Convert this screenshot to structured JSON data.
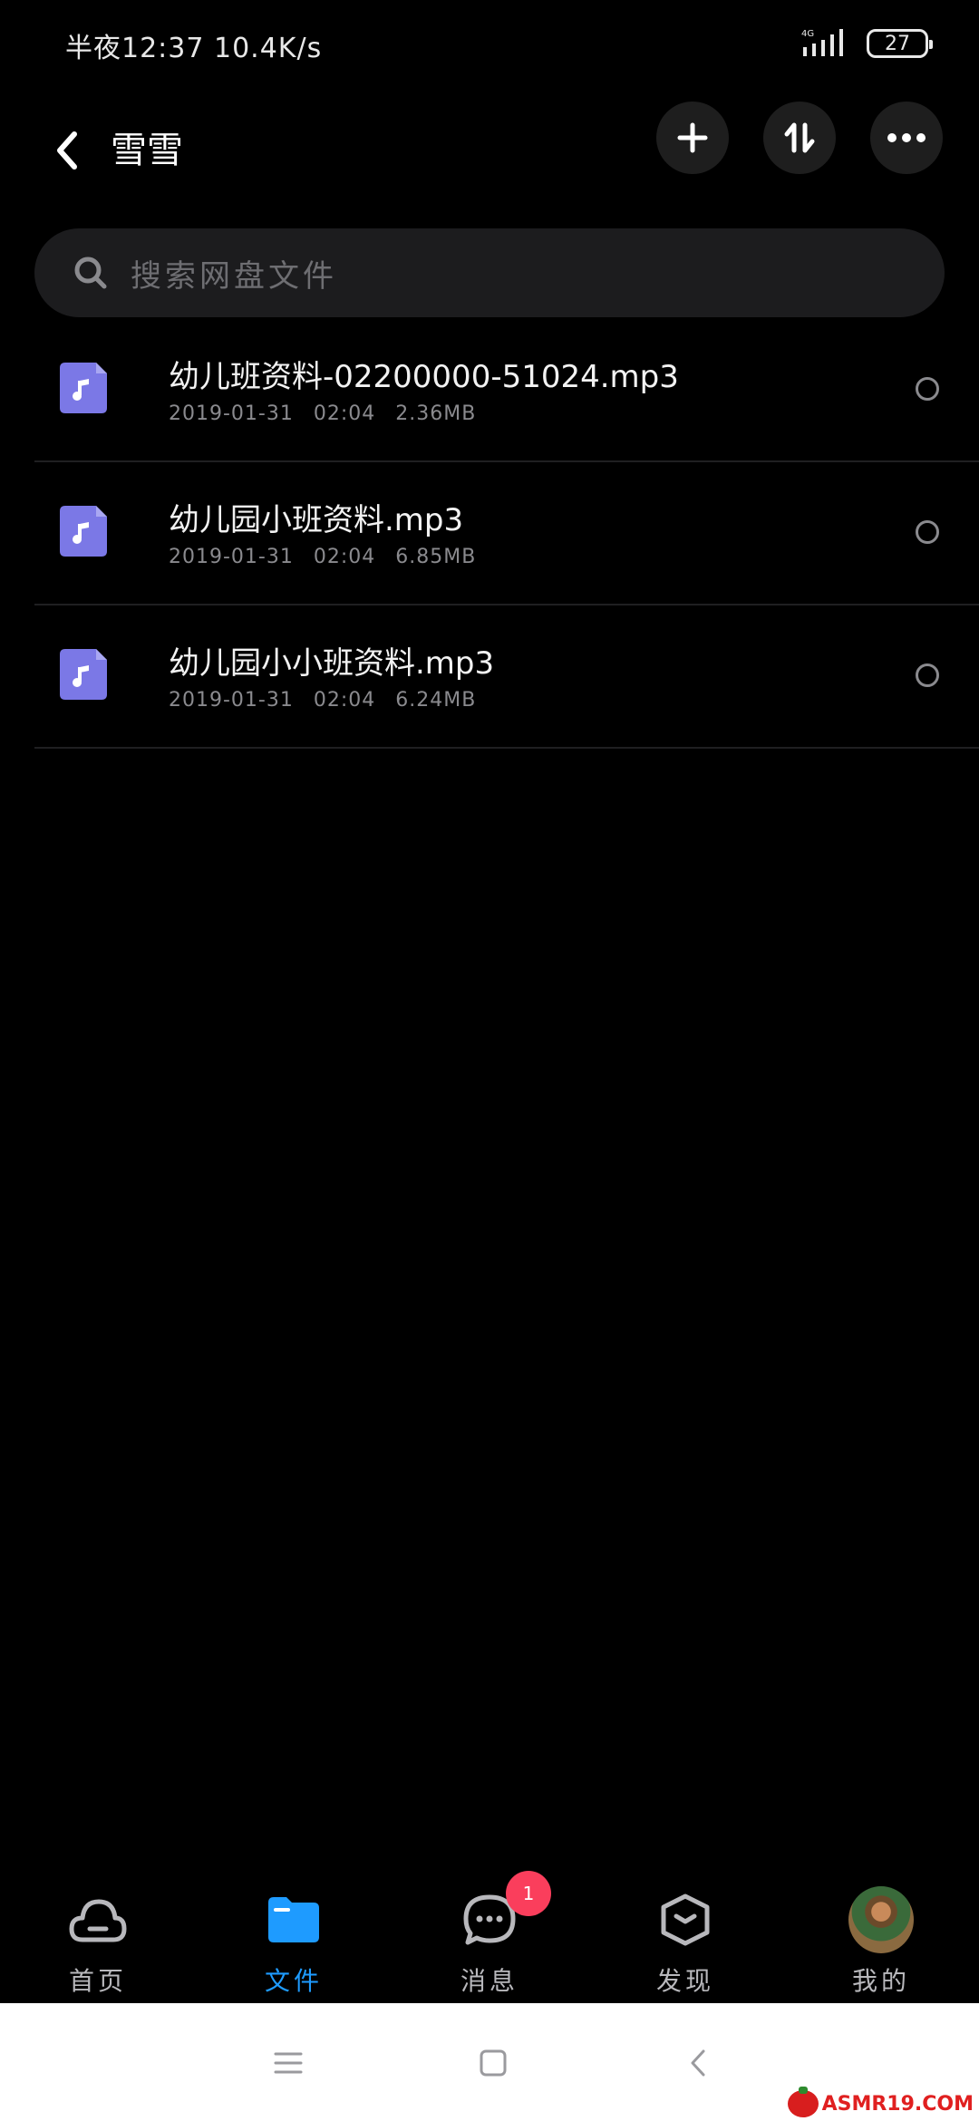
{
  "status_bar": {
    "time_and_speed": "半夜12:37 10.4K/s",
    "network": "4G",
    "battery": "27"
  },
  "header": {
    "title": "雪雪"
  },
  "search": {
    "placeholder": "搜索网盘文件"
  },
  "files": [
    {
      "name": "幼儿班资料-02200000-51024.mp3",
      "date": "2019-01-31",
      "time": "02:04",
      "size": "2.36MB"
    },
    {
      "name": "幼儿园小班资料.mp3",
      "date": "2019-01-31",
      "time": "02:04",
      "size": "6.85MB"
    },
    {
      "name": "幼儿园小小班资料.mp3",
      "date": "2019-01-31",
      "time": "02:04",
      "size": "6.24MB"
    }
  ],
  "bottom_nav": {
    "items": [
      {
        "label": "首页",
        "icon": "cloud-icon"
      },
      {
        "label": "文件",
        "icon": "folder-icon",
        "active": true
      },
      {
        "label": "消息",
        "icon": "chat-icon",
        "badge": "1"
      },
      {
        "label": "发现",
        "icon": "cube-icon"
      },
      {
        "label": "我的",
        "icon": "avatar"
      }
    ]
  },
  "watermark": "ASMR19.COM",
  "colors": {
    "background": "#000000",
    "accent": "#1e9bff",
    "file_icon": "#7b78e6",
    "badge": "#fa3e5c"
  }
}
